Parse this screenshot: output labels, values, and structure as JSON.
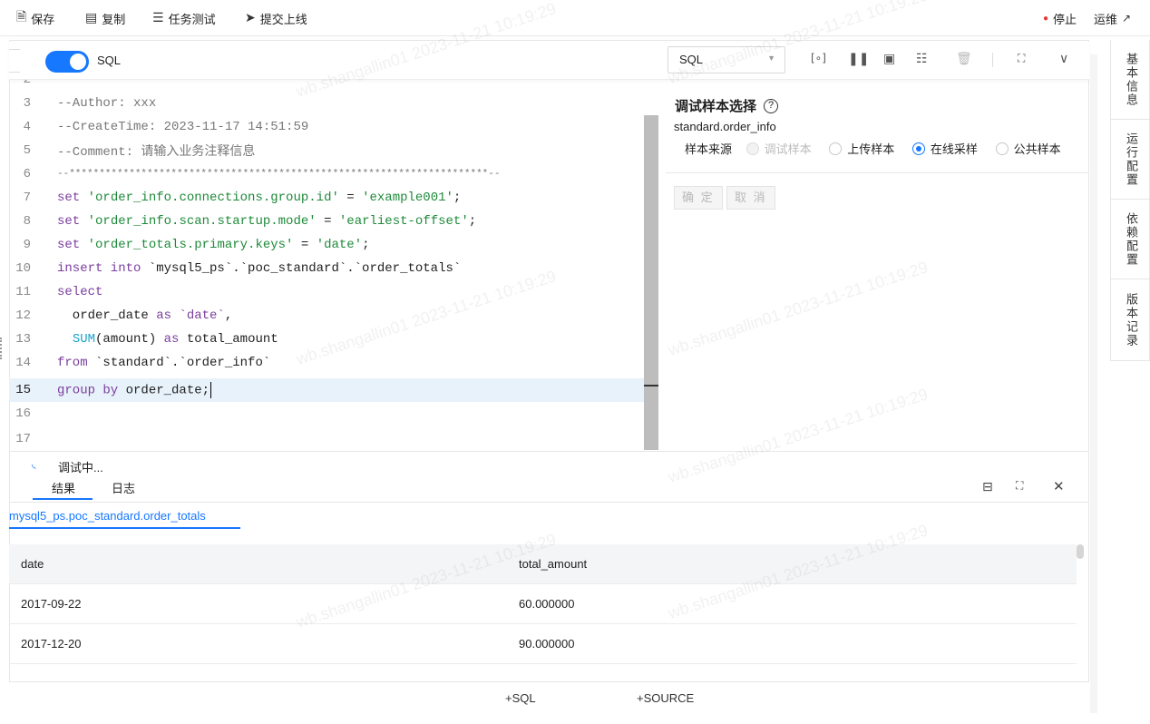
{
  "toolbar": {
    "save": "保存",
    "copy": "复制",
    "task_test": "任务测试",
    "submit": "提交上线",
    "stop": "停止",
    "ops": "运维",
    "stop_dot_color": "#e53935"
  },
  "subbar": {
    "toggle_label": "SQL",
    "select_value": "SQL"
  },
  "editor": {
    "lines": [
      {
        "n": "2",
        "text": ""
      },
      {
        "n": "3",
        "text": "--Author: xxx"
      },
      {
        "n": "4",
        "text": "--CreateTime: 2023-11-17 14:51:59"
      },
      {
        "n": "5",
        "text": "--Comment: 请输入业务注释信息"
      },
      {
        "n": "6",
        "text": "--**********************************************************************--"
      },
      {
        "n": "7",
        "text": "set 'order_info.connections.group.id' = 'example001';"
      },
      {
        "n": "8",
        "text": "set 'order_info.scan.startup.mode' = 'earliest-offset';"
      },
      {
        "n": "9",
        "text": "set 'order_totals.primary.keys' = 'date';"
      },
      {
        "n": "10",
        "text": "insert into `mysql5_ps`.`poc_standard`.`order_totals`"
      },
      {
        "n": "11",
        "text": "select"
      },
      {
        "n": "12",
        "text": "  order_date as `date`,"
      },
      {
        "n": "13",
        "text": "  SUM(amount) as total_amount"
      },
      {
        "n": "14",
        "text": "from `standard`.`order_info`"
      },
      {
        "n": "15",
        "text": "group by order_date;"
      },
      {
        "n": "16",
        "text": ""
      },
      {
        "n": "17",
        "text": ""
      }
    ]
  },
  "debug": {
    "title": "调试样本选择",
    "table": "standard.order_info",
    "source_label": "样本来源",
    "options": [
      "调试样本",
      "上传样本",
      "在线采样",
      "公共样本"
    ],
    "selected": "在线采样",
    "confirm": "确 定",
    "cancel": "取 消"
  },
  "results": {
    "status": "调试中...",
    "tabs": [
      "结果",
      "日志"
    ],
    "active_tab": "结果",
    "table_tab": "mysql5_ps.poc_standard.order_totals",
    "columns": [
      "date",
      "total_amount"
    ],
    "rows": [
      [
        "2017-09-22",
        "60.000000"
      ],
      [
        "2017-12-20",
        "90.000000"
      ]
    ]
  },
  "footer": {
    "add_sql": "+SQL",
    "add_source": "+SOURCE"
  },
  "side_tabs": [
    "基本信息",
    "运行配置",
    "依赖配置",
    "版本记录"
  ],
  "watermark": "wb.shangallin01 2023-11-21 10:19:29",
  "accent": "#1677ff"
}
